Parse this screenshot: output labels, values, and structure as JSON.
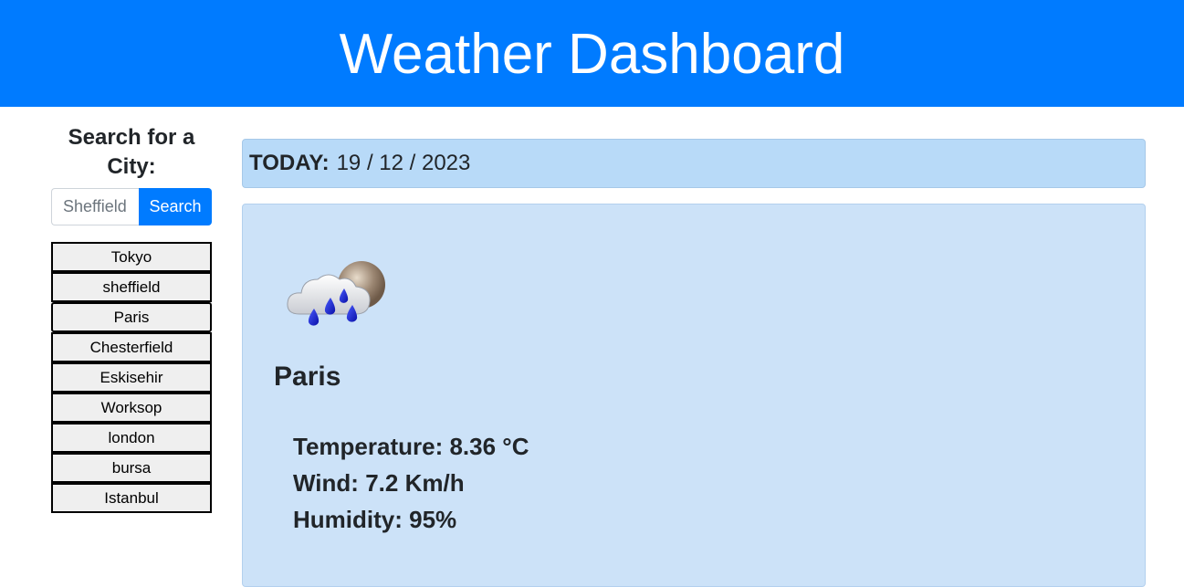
{
  "header": {
    "title": "Weather Dashboard",
    "background": "#007bff"
  },
  "search": {
    "heading": "Search for a City:",
    "placeholder": "Sheffield",
    "button_label": "Search"
  },
  "history": {
    "items": [
      {
        "label": "Tokyo"
      },
      {
        "label": "sheffield"
      },
      {
        "label": "Paris"
      },
      {
        "label": "Chesterfield"
      },
      {
        "label": "Eskisehir"
      },
      {
        "label": "Worksop"
      },
      {
        "label": "london"
      },
      {
        "label": "bursa"
      },
      {
        "label": "Istanbul"
      }
    ]
  },
  "today": {
    "label": "TODAY:",
    "date": "19 / 12 / 2023"
  },
  "current": {
    "icon": "rain-cloud-icon",
    "city": "Paris",
    "temperature_label": "Temperature:",
    "temperature_value": "8.36 °C",
    "wind_label": "Wind:",
    "wind_value": "7.2 Km/h",
    "humidity_label": "Humidity:",
    "humidity_value": "95%"
  },
  "colors": {
    "accent": "#007bff",
    "today_bg": "#b8daf8",
    "card_bg": "#cce2f8"
  }
}
